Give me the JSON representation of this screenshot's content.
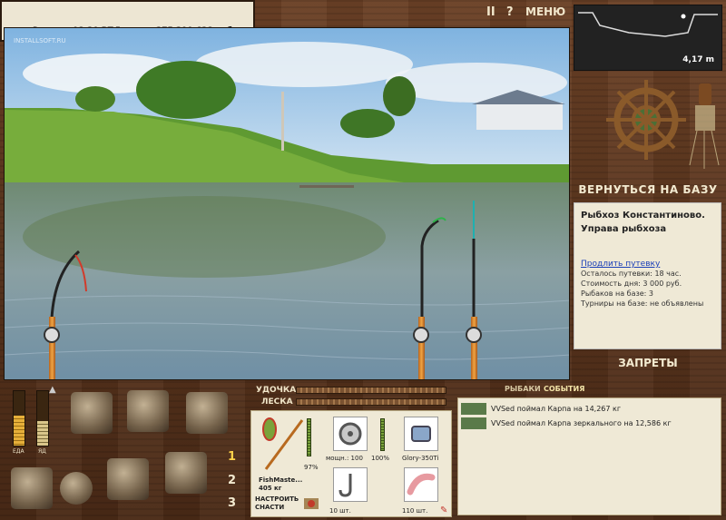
{
  "status": {
    "time_label": "Время:",
    "time_value": "08:20 ВТ",
    "money_label": "Деньги:",
    "money_value": "275 399 628 руб.",
    "watermark": "INSTALLSOFT.RU"
  },
  "top_controls": {
    "pause": "II",
    "help": "?",
    "menu": "МЕНЮ"
  },
  "depth": {
    "value": "4,17 m"
  },
  "nav": {
    "back_to_base": "ВЕРНУТЬСЯ НА БАЗУ",
    "bans": "ЗАПРЕТЫ"
  },
  "farm": {
    "title": "Рыбхоз Константиново. Управа рыбхоза",
    "extend_link": "Продлить путевку",
    "rows": [
      "Осталось путевки: 18 час.",
      "Стоимость дня: 3 000 руб.",
      "Рыбаков на базе: 3",
      "Турниры на базе: не объявлены"
    ]
  },
  "gear_bars": {
    "rod_label": "УДОЧКА",
    "line_label": "ЛЕСКА"
  },
  "tabs": {
    "fishers": "РЫБАКИ",
    "events": "СОБЫТИЯ"
  },
  "events": [
    "VVSed поймал Карпа на 14,267 кг",
    "VVSed поймал Карпа зеркального на 12,586 кг"
  ],
  "meters": {
    "food_label": "ЕДА",
    "poison_label": "ЯД",
    "food_level": 0.55,
    "poison_level": 0.45
  },
  "rod_slots": [
    "1",
    "2",
    "3"
  ],
  "tackle": {
    "rod_name": "FishMaste...",
    "rod_weight": "405 кг",
    "rod_condition": "97%",
    "reel_power": "мощн.: 100",
    "reel_condition": "100%",
    "line_name": "Glory-350Ti",
    "hooks_count": "10 шт.",
    "bait_count": "110 шт.",
    "setup_label": "НАСТРОИТЬ СНАСТИ"
  },
  "colors": {
    "panel_bg": "#efe9d6",
    "wood_dark": "#4a2a16",
    "link": "#1a3fb8",
    "text_light": "#f3ead0"
  }
}
